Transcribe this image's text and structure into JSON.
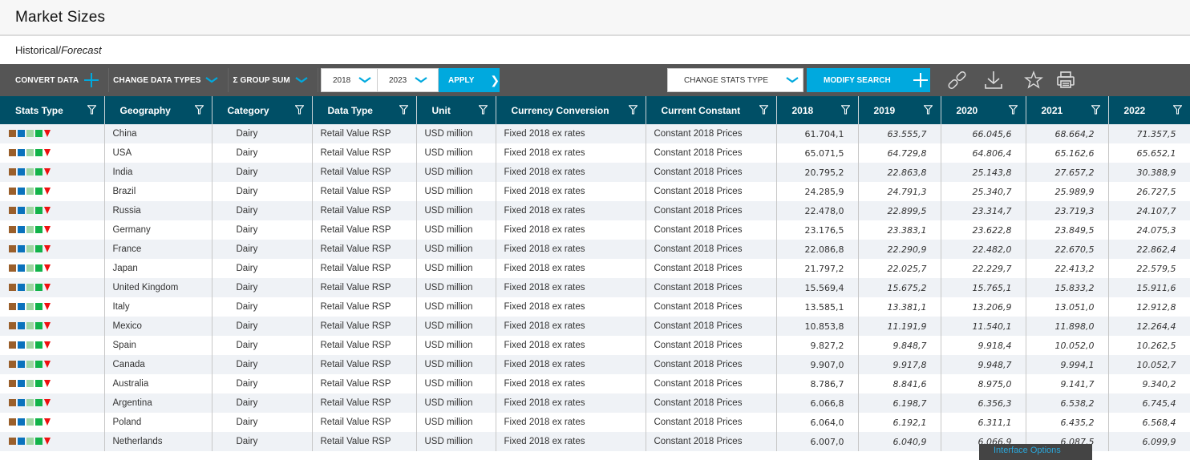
{
  "header": {
    "title": "Market Sizes"
  },
  "subheader": {
    "historical": "Historical/",
    "forecast": "Forecast"
  },
  "toolbar": {
    "convert_data": "CONVERT DATA",
    "change_data_types": "CHANGE DATA TYPES",
    "group_sum": "Σ GROUP SUM",
    "year_from": "2018",
    "year_to": "2023",
    "apply": "APPLY",
    "change_stats_type": "CHANGE STATS TYPE",
    "modify_search": "MODIFY SEARCH",
    "icons": [
      "link-icon",
      "download-icon",
      "star-icon",
      "print-icon"
    ]
  },
  "colors": {
    "accent": "#00a9de",
    "table_header": "#004f66",
    "toolbar": "#555555",
    "stats_icons": [
      "#9a5f2b",
      "#0a72bd",
      "#9fd6a2",
      "#12b34a",
      "#ee1111"
    ]
  },
  "table": {
    "columns": [
      "Stats Type",
      "Geography",
      "Category",
      "Data Type",
      "Unit",
      "Currency Conversion",
      "Current Constant",
      "2018",
      "2019",
      "2020",
      "2021",
      "2022"
    ],
    "rows": [
      {
        "geography": "China",
        "category": "Dairy",
        "data_type": "Retail Value RSP",
        "unit": "USD million",
        "currency": "Fixed 2018 ex rates",
        "constant": "Constant 2018 Prices",
        "values": [
          "61.704,1",
          "63.555,7",
          "66.045,6",
          "68.664,2",
          "71.357,5"
        ]
      },
      {
        "geography": "USA",
        "category": "Dairy",
        "data_type": "Retail Value RSP",
        "unit": "USD million",
        "currency": "Fixed 2018 ex rates",
        "constant": "Constant 2018 Prices",
        "values": [
          "65.071,5",
          "64.729,8",
          "64.806,4",
          "65.162,6",
          "65.652,1"
        ]
      },
      {
        "geography": "India",
        "category": "Dairy",
        "data_type": "Retail Value RSP",
        "unit": "USD million",
        "currency": "Fixed 2018 ex rates",
        "constant": "Constant 2018 Prices",
        "values": [
          "20.795,2",
          "22.863,8",
          "25.143,8",
          "27.657,2",
          "30.388,9"
        ]
      },
      {
        "geography": "Brazil",
        "category": "Dairy",
        "data_type": "Retail Value RSP",
        "unit": "USD million",
        "currency": "Fixed 2018 ex rates",
        "constant": "Constant 2018 Prices",
        "values": [
          "24.285,9",
          "24.791,3",
          "25.340,7",
          "25.989,9",
          "26.727,5"
        ]
      },
      {
        "geography": "Russia",
        "category": "Dairy",
        "data_type": "Retail Value RSP",
        "unit": "USD million",
        "currency": "Fixed 2018 ex rates",
        "constant": "Constant 2018 Prices",
        "values": [
          "22.478,0",
          "22.899,5",
          "23.314,7",
          "23.719,3",
          "24.107,7"
        ]
      },
      {
        "geography": "Germany",
        "category": "Dairy",
        "data_type": "Retail Value RSP",
        "unit": "USD million",
        "currency": "Fixed 2018 ex rates",
        "constant": "Constant 2018 Prices",
        "values": [
          "23.176,5",
          "23.383,1",
          "23.622,8",
          "23.849,5",
          "24.075,3"
        ]
      },
      {
        "geography": "France",
        "category": "Dairy",
        "data_type": "Retail Value RSP",
        "unit": "USD million",
        "currency": "Fixed 2018 ex rates",
        "constant": "Constant 2018 Prices",
        "values": [
          "22.086,8",
          "22.290,9",
          "22.482,0",
          "22.670,5",
          "22.862,4"
        ]
      },
      {
        "geography": "Japan",
        "category": "Dairy",
        "data_type": "Retail Value RSP",
        "unit": "USD million",
        "currency": "Fixed 2018 ex rates",
        "constant": "Constant 2018 Prices",
        "values": [
          "21.797,2",
          "22.025,7",
          "22.229,7",
          "22.413,2",
          "22.579,5"
        ]
      },
      {
        "geography": "United Kingdom",
        "category": "Dairy",
        "data_type": "Retail Value RSP",
        "unit": "USD million",
        "currency": "Fixed 2018 ex rates",
        "constant": "Constant 2018 Prices",
        "values": [
          "15.569,4",
          "15.675,2",
          "15.765,1",
          "15.833,2",
          "15.911,6"
        ]
      },
      {
        "geography": "Italy",
        "category": "Dairy",
        "data_type": "Retail Value RSP",
        "unit": "USD million",
        "currency": "Fixed 2018 ex rates",
        "constant": "Constant 2018 Prices",
        "values": [
          "13.585,1",
          "13.381,1",
          "13.206,9",
          "13.051,0",
          "12.912,8"
        ]
      },
      {
        "geography": "Mexico",
        "category": "Dairy",
        "data_type": "Retail Value RSP",
        "unit": "USD million",
        "currency": "Fixed 2018 ex rates",
        "constant": "Constant 2018 Prices",
        "values": [
          "10.853,8",
          "11.191,9",
          "11.540,1",
          "11.898,0",
          "12.264,4"
        ]
      },
      {
        "geography": "Spain",
        "category": "Dairy",
        "data_type": "Retail Value RSP",
        "unit": "USD million",
        "currency": "Fixed 2018 ex rates",
        "constant": "Constant 2018 Prices",
        "values": [
          "9.827,2",
          "9.848,7",
          "9.918,4",
          "10.052,0",
          "10.262,5"
        ]
      },
      {
        "geography": "Canada",
        "category": "Dairy",
        "data_type": "Retail Value RSP",
        "unit": "USD million",
        "currency": "Fixed 2018 ex rates",
        "constant": "Constant 2018 Prices",
        "values": [
          "9.907,0",
          "9.917,8",
          "9.948,7",
          "9.994,1",
          "10.052,7"
        ]
      },
      {
        "geography": "Australia",
        "category": "Dairy",
        "data_type": "Retail Value RSP",
        "unit": "USD million",
        "currency": "Fixed 2018 ex rates",
        "constant": "Constant 2018 Prices",
        "values": [
          "8.786,7",
          "8.841,6",
          "8.975,0",
          "9.141,7",
          "9.340,2"
        ]
      },
      {
        "geography": "Argentina",
        "category": "Dairy",
        "data_type": "Retail Value RSP",
        "unit": "USD million",
        "currency": "Fixed 2018 ex rates",
        "constant": "Constant 2018 Prices",
        "values": [
          "6.066,8",
          "6.198,7",
          "6.356,3",
          "6.538,2",
          "6.745,4"
        ]
      },
      {
        "geography": "Poland",
        "category": "Dairy",
        "data_type": "Retail Value RSP",
        "unit": "USD million",
        "currency": "Fixed 2018 ex rates",
        "constant": "Constant 2018 Prices",
        "values": [
          "6.064,0",
          "6.192,1",
          "6.311,1",
          "6.435,2",
          "6.568,4"
        ]
      },
      {
        "geography": "Netherlands",
        "category": "Dairy",
        "data_type": "Retail Value RSP",
        "unit": "USD million",
        "currency": "Fixed 2018 ex rates",
        "constant": "Constant 2018 Prices",
        "values": [
          "6.007,0",
          "6.040,9",
          "6.066,9",
          "6.087,5",
          "6.099,9"
        ]
      }
    ]
  },
  "interface_options": {
    "label": "Interface Options"
  }
}
